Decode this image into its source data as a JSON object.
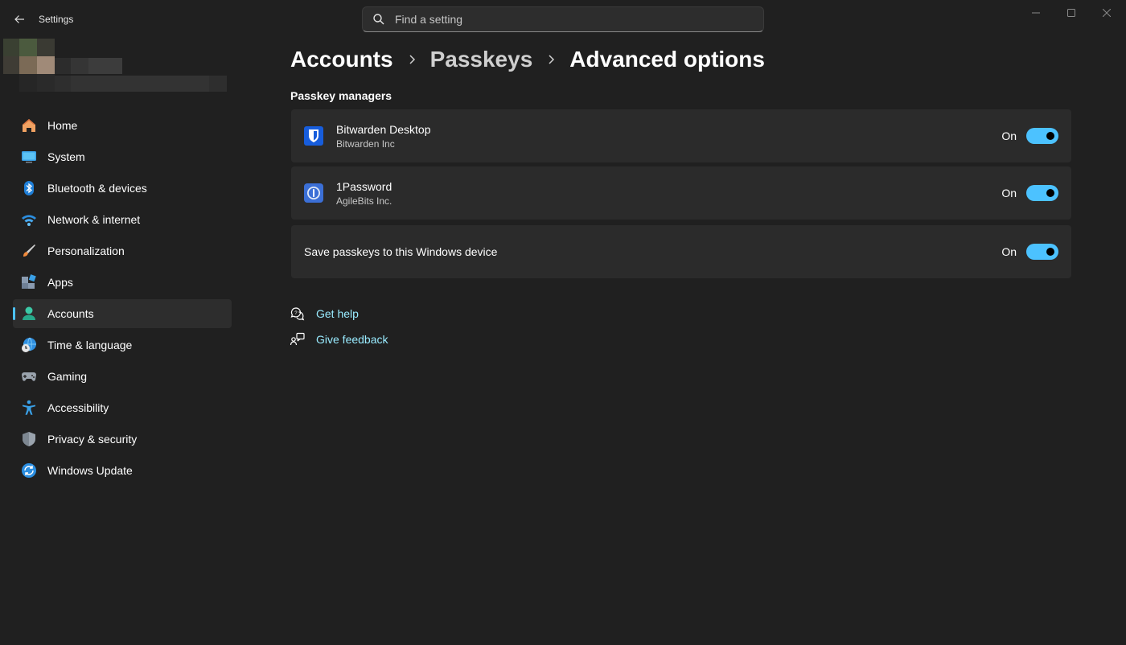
{
  "window": {
    "title": "Settings",
    "controls": {
      "minimize_icon": "minimize-icon",
      "maximize_icon": "maximize-icon",
      "close_icon": "close-icon"
    }
  },
  "search": {
    "placeholder": "Find a setting",
    "value": ""
  },
  "sidebar": {
    "items": [
      {
        "label": "Home",
        "icon": "home-icon"
      },
      {
        "label": "System",
        "icon": "system-icon"
      },
      {
        "label": "Bluetooth & devices",
        "icon": "bluetooth-icon"
      },
      {
        "label": "Network & internet",
        "icon": "wifi-icon"
      },
      {
        "label": "Personalization",
        "icon": "brush-icon"
      },
      {
        "label": "Apps",
        "icon": "apps-icon"
      },
      {
        "label": "Accounts",
        "icon": "accounts-icon",
        "active": true
      },
      {
        "label": "Time & language",
        "icon": "globe-clock-icon"
      },
      {
        "label": "Gaming",
        "icon": "gamepad-icon"
      },
      {
        "label": "Accessibility",
        "icon": "accessibility-icon"
      },
      {
        "label": "Privacy & security",
        "icon": "shield-icon"
      },
      {
        "label": "Windows Update",
        "icon": "update-icon"
      }
    ]
  },
  "breadcrumb": [
    "Accounts",
    "Passkeys",
    "Advanced options"
  ],
  "section": {
    "title": "Passkey managers"
  },
  "cards": [
    {
      "name": "Bitwarden Desktop",
      "publisher": "Bitwarden Inc",
      "toggle_label": "On",
      "toggle_on": true,
      "icon": "bitwarden-icon"
    },
    {
      "name": "1Password",
      "publisher": "AgileBits Inc.",
      "toggle_label": "On",
      "toggle_on": true,
      "icon": "onepassword-icon"
    },
    {
      "label": "Save passkeys to this Windows device",
      "toggle_label": "On",
      "toggle_on": true
    }
  ],
  "links": [
    {
      "label": "Get help",
      "icon": "help-chat-icon"
    },
    {
      "label": "Give feedback",
      "icon": "feedback-icon"
    }
  ],
  "colors": {
    "accent": "#4cc2ff",
    "link": "#99ebff",
    "background": "#202020",
    "card": "#2b2b2b"
  }
}
